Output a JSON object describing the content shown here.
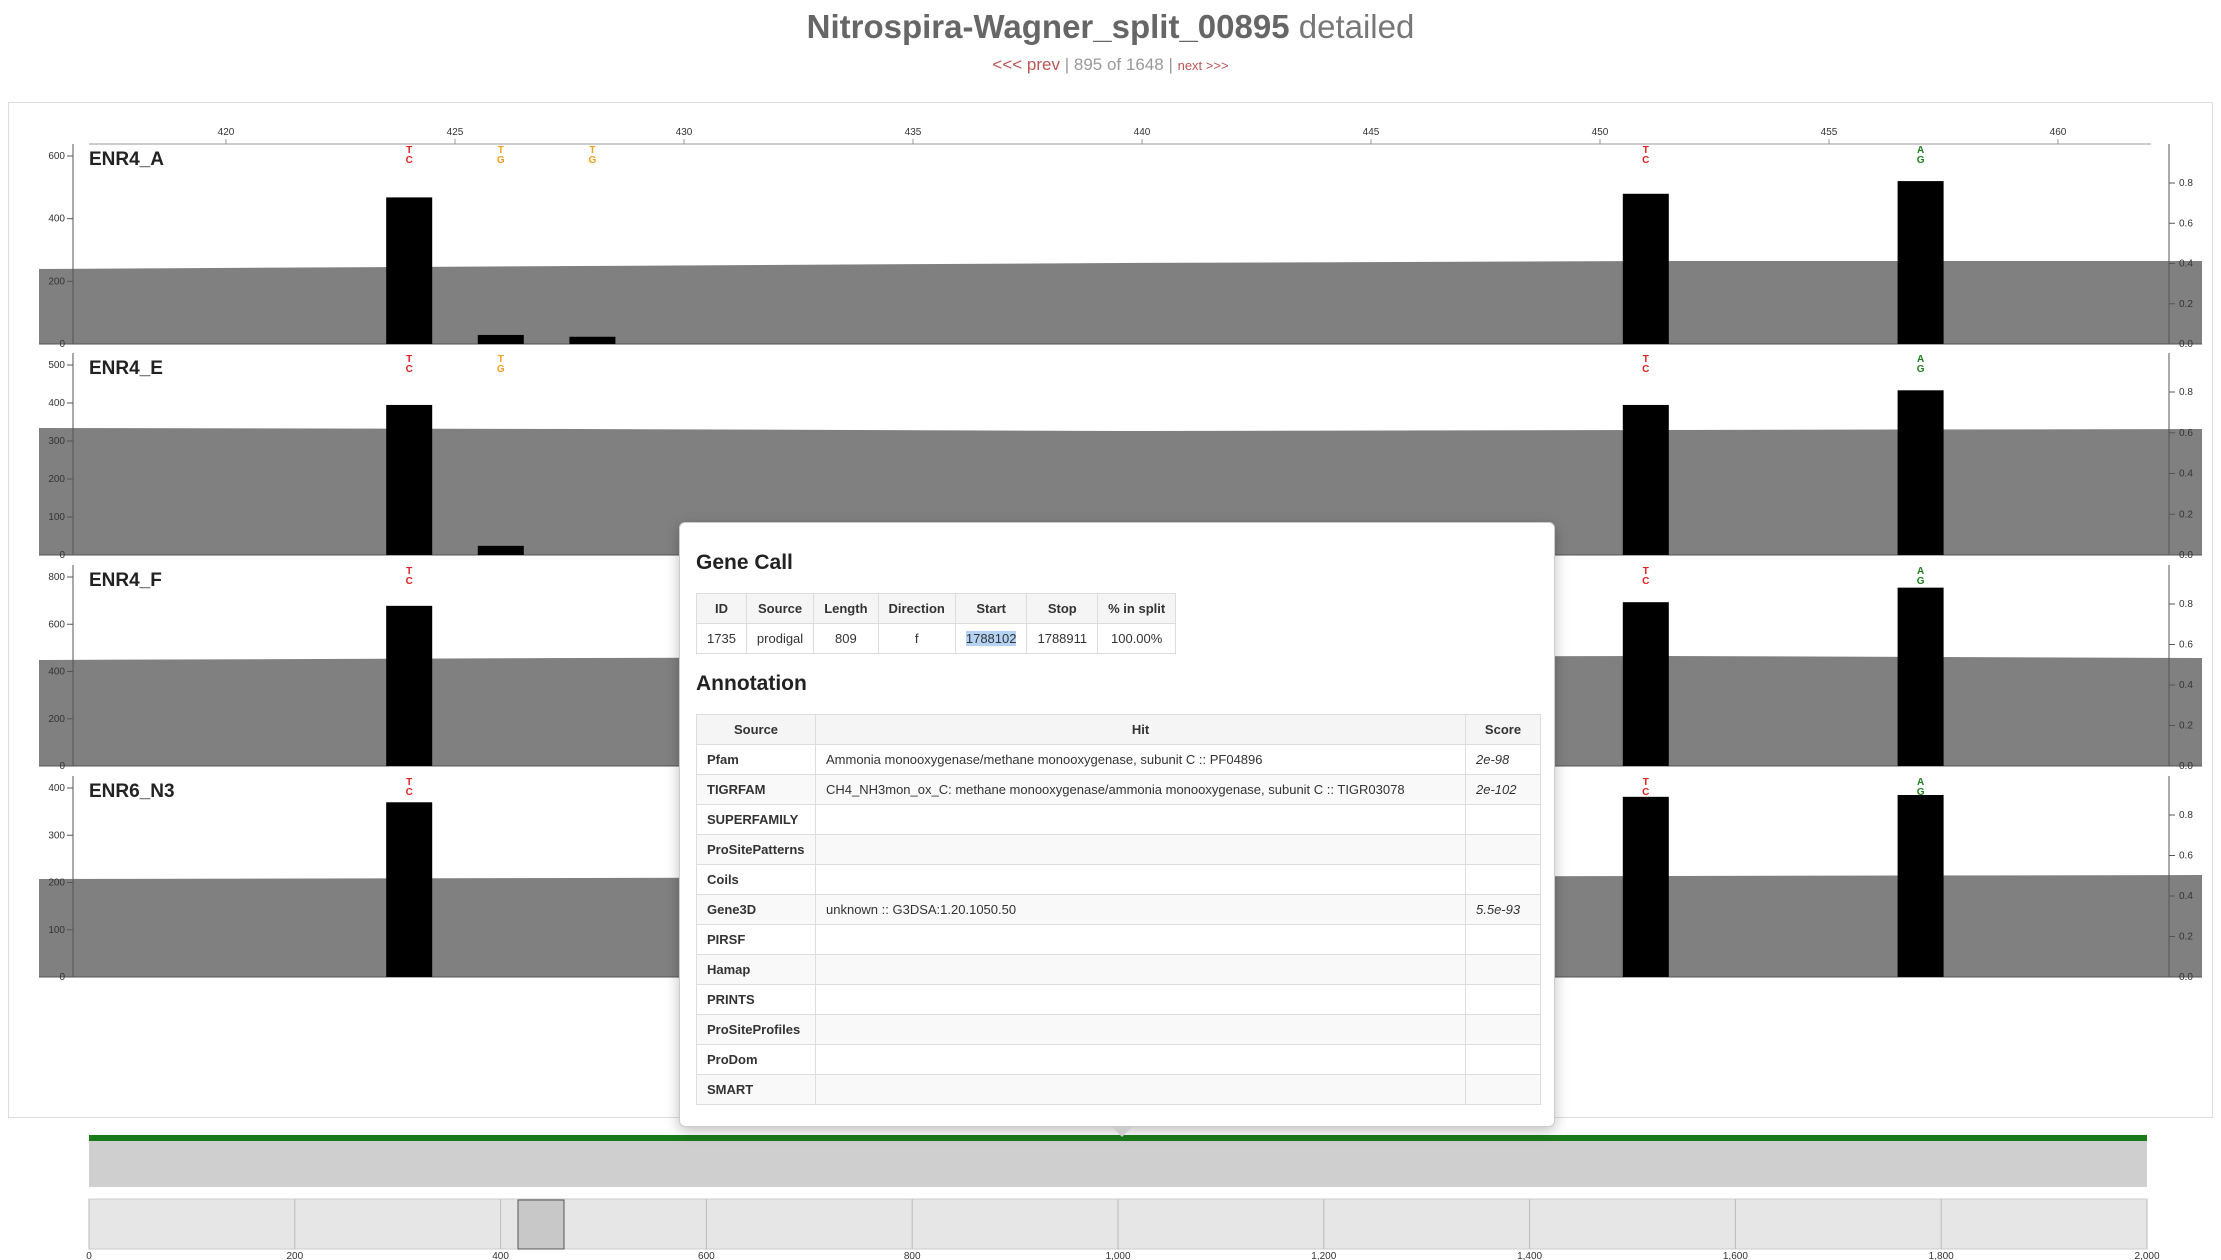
{
  "header": {
    "split_name": "Nitrospira-Wagner_split_00895",
    "title_suffix": "detailed",
    "prev_label": "<<< prev",
    "position_text": "895 of 1648",
    "next_label": "next >>>"
  },
  "ruler": {
    "ticks": [
      "420",
      "425",
      "430",
      "435",
      "440",
      "445",
      "450",
      "455",
      "460"
    ]
  },
  "colors": {
    "coverage_fill": "#808080",
    "bar_fill": "#000000",
    "snv_red": "#e02020",
    "snv_orange": "#f0a020",
    "snv_green": "#208020",
    "gene_line": "#1a7a1a"
  },
  "samples": [
    {
      "name": "ENR4_A",
      "left_ticks": [
        "600",
        "400",
        "200",
        "0"
      ],
      "right_ticks": [
        "0.8",
        "0.6",
        "0.4",
        "0.2",
        "0.0"
      ],
      "snvs": [
        {
          "pos": 424,
          "top": "T",
          "bottom": "C",
          "color": "red"
        },
        {
          "pos": 426,
          "top": "T",
          "bottom": "G",
          "color": "orange"
        },
        {
          "pos": 428,
          "top": "T",
          "bottom": "G",
          "color": "orange"
        },
        {
          "pos": 451,
          "top": "T",
          "bottom": "C",
          "color": "red"
        },
        {
          "pos": 457,
          "top": "A",
          "bottom": "G",
          "color": "green"
        }
      ],
      "bars": [
        {
          "pos": 424,
          "value": 0.81
        },
        {
          "pos": 426,
          "value": 0.05
        },
        {
          "pos": 428,
          "value": 0.04
        },
        {
          "pos": 451,
          "value": 0.83
        },
        {
          "pos": 457,
          "value": 0.9
        }
      ]
    },
    {
      "name": "ENR4_E",
      "left_ticks": [
        "500",
        "400",
        "300",
        "200",
        "100",
        "0"
      ],
      "right_ticks": [
        "0.8",
        "0.6",
        "0.4",
        "0.2",
        "0.0"
      ],
      "snvs": [
        {
          "pos": 424,
          "top": "T",
          "bottom": "C",
          "color": "red"
        },
        {
          "pos": 426,
          "top": "T",
          "bottom": "G",
          "color": "orange"
        },
        {
          "pos": 451,
          "top": "T",
          "bottom": "C",
          "color": "red"
        },
        {
          "pos": 457,
          "top": "A",
          "bottom": "G",
          "color": "green"
        }
      ],
      "bars": [
        {
          "pos": 424,
          "value": 0.82
        },
        {
          "pos": 426,
          "value": 0.05
        },
        {
          "pos": 451,
          "value": 0.82
        },
        {
          "pos": 457,
          "value": 0.9
        }
      ]
    },
    {
      "name": "ENR4_F",
      "left_ticks": [
        "800",
        "600",
        "400",
        "200",
        "0"
      ],
      "right_ticks": [
        "0.8",
        "0.6",
        "0.4",
        "0.2",
        "0.0"
      ],
      "snvs": [
        {
          "pos": 424,
          "top": "T",
          "bottom": "C",
          "color": "red"
        },
        {
          "pos": 451,
          "top": "T",
          "bottom": "C",
          "color": "red"
        },
        {
          "pos": 457,
          "top": "A",
          "bottom": "G",
          "color": "green"
        }
      ],
      "bars": [
        {
          "pos": 424,
          "value": 0.88
        },
        {
          "pos": 451,
          "value": 0.9
        },
        {
          "pos": 457,
          "value": 0.98
        }
      ]
    },
    {
      "name": "ENR6_N3",
      "left_ticks": [
        "400",
        "300",
        "200",
        "100",
        "0"
      ],
      "right_ticks": [
        "0.8",
        "0.6",
        "0.4",
        "0.2",
        "0.0"
      ],
      "snvs": [
        {
          "pos": 424,
          "top": "T",
          "bottom": "C",
          "color": "red"
        },
        {
          "pos": 451,
          "top": "T",
          "bottom": "C",
          "color": "red"
        },
        {
          "pos": 457,
          "top": "A",
          "bottom": "G",
          "color": "green"
        }
      ],
      "bars": [
        {
          "pos": 424,
          "value": 0.96
        },
        {
          "pos": 451,
          "value": 0.99
        },
        {
          "pos": 457,
          "value": 1.0
        }
      ]
    }
  ],
  "overview_axis": {
    "ticks": [
      "0",
      "200",
      "400",
      "600",
      "800",
      "1,000",
      "1,200",
      "1,400",
      "1,600",
      "1,800",
      "2,000"
    ]
  },
  "popup": {
    "gene_call_title": "Gene Call",
    "gene_call_headers": [
      "ID",
      "Source",
      "Length",
      "Direction",
      "Start",
      "Stop",
      "% in split"
    ],
    "gene_call_row": [
      "1735",
      "prodigal",
      "809",
      "f",
      "1788102",
      "1788911",
      "100.00%"
    ],
    "annotation_title": "Annotation",
    "annotation_headers": [
      "Source",
      "Hit",
      "Score"
    ],
    "annotation_rows": [
      {
        "source": "Pfam",
        "hit": "Ammonia monooxygenase/methane monooxygenase, subunit C :: PF04896",
        "score": "2e-98"
      },
      {
        "source": "TIGRFAM",
        "hit": "CH4_NH3mon_ox_C: methane monooxygenase/ammonia monooxygenase, subunit C :: TIGR03078",
        "score": "2e-102"
      },
      {
        "source": "SUPERFAMILY",
        "hit": "",
        "score": ""
      },
      {
        "source": "ProSitePatterns",
        "hit": "",
        "score": ""
      },
      {
        "source": "Coils",
        "hit": "",
        "score": ""
      },
      {
        "source": "Gene3D",
        "hit": "unknown :: G3DSA:1.20.1050.50",
        "score": "5.5e-93"
      },
      {
        "source": "PIRSF",
        "hit": "",
        "score": ""
      },
      {
        "source": "Hamap",
        "hit": "",
        "score": ""
      },
      {
        "source": "PRINTS",
        "hit": "",
        "score": ""
      },
      {
        "source": "ProSiteProfiles",
        "hit": "",
        "score": ""
      },
      {
        "source": "ProDom",
        "hit": "",
        "score": ""
      },
      {
        "source": "SMART",
        "hit": "",
        "score": ""
      }
    ]
  }
}
